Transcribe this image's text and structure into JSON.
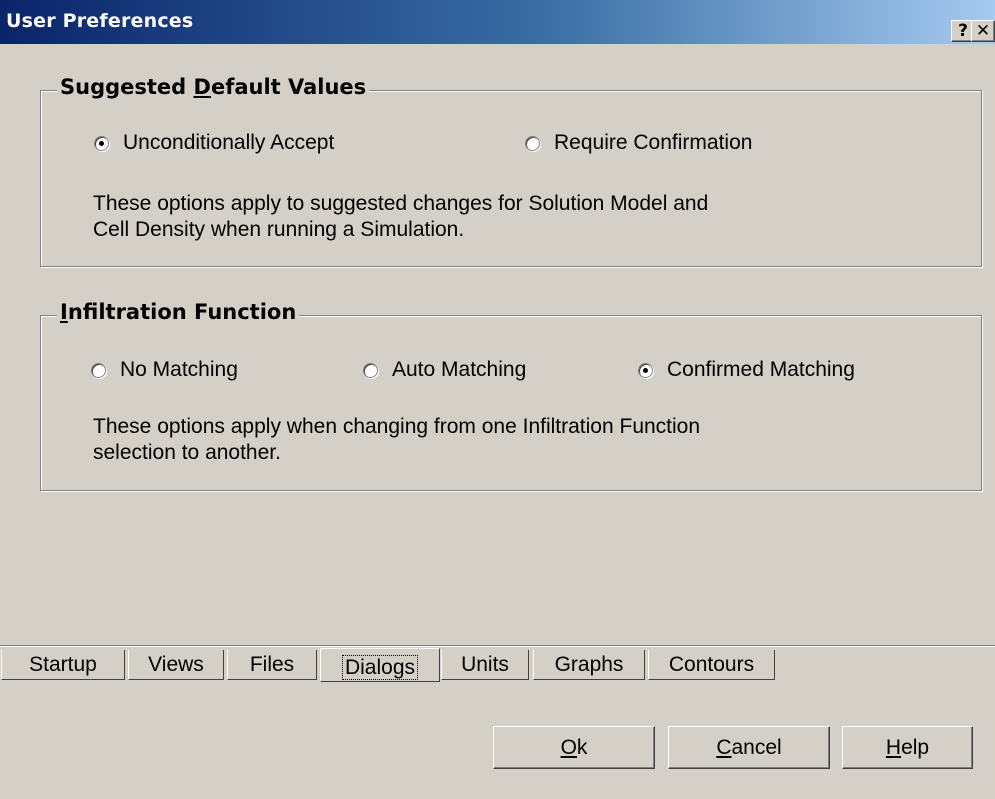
{
  "window": {
    "title": "User Preferences",
    "help_glyph": "?",
    "close_glyph": "✕"
  },
  "default_values": {
    "title_pre": "Suggested ",
    "title_accel": "D",
    "title_post": "efault Values",
    "options": [
      {
        "label": "Unconditionally Accept",
        "selected": true
      },
      {
        "label": "Require Confirmation",
        "selected": false
      }
    ],
    "desc_line1": "These options apply to suggested changes for Solution Model and",
    "desc_line2": "Cell Density when running a Simulation."
  },
  "infiltration": {
    "title_accel": "I",
    "title_post": "nfiltration Function",
    "options": [
      {
        "label": "No Matching",
        "selected": false
      },
      {
        "label": "Auto Matching",
        "selected": false
      },
      {
        "label": "Confirmed Matching",
        "selected": true
      }
    ],
    "desc_line1": "These options apply when changing from one Infiltration Function",
    "desc_line2": "selection to another."
  },
  "tabs": [
    {
      "label": "Startup"
    },
    {
      "label": "Views"
    },
    {
      "label": "Files"
    },
    {
      "label": "Dialogs",
      "active": true
    },
    {
      "label": "Units"
    },
    {
      "label": "Graphs"
    },
    {
      "label": "Contours"
    }
  ],
  "buttons": {
    "ok_accel": "O",
    "ok_rest": "k",
    "cancel_accel": "C",
    "cancel_rest": "ancel",
    "help_accel": "H",
    "help_rest": "elp"
  }
}
